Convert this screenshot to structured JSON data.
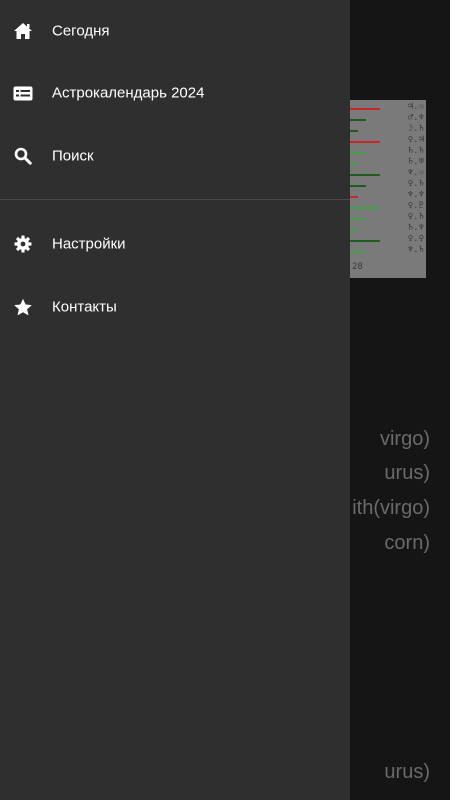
{
  "drawer": {
    "items": [
      {
        "label": "Сегодня",
        "icon": "home-icon"
      },
      {
        "label": "Астрокалендарь 2024",
        "icon": "calendar-list-icon"
      },
      {
        "label": "Поиск",
        "icon": "search-icon"
      },
      {
        "label": "Настройки",
        "icon": "gear-icon"
      },
      {
        "label": "Контакты",
        "icon": "star-icon"
      }
    ]
  },
  "background": {
    "chart_footer": "28",
    "chart_rows": [
      {
        "glyph": "♃.☉",
        "color": "#c62828"
      },
      {
        "glyph": "♂.♆",
        "color": "#1b5e20"
      },
      {
        "glyph": "☽.♄",
        "color": "#1b5e20"
      },
      {
        "glyph": "♀.♃",
        "color": "#c62828"
      },
      {
        "glyph": "♄.♄",
        "color": "#43a047"
      },
      {
        "glyph": "♄.♅",
        "color": "#43a047"
      },
      {
        "glyph": "♆.☉",
        "color": "#1b5e20"
      },
      {
        "glyph": "♀.♄",
        "color": "#1b5e20"
      },
      {
        "glyph": "♆.♆",
        "color": "#c62828"
      },
      {
        "glyph": "♀.♇",
        "color": "#43a047"
      },
      {
        "glyph": "♀.♄",
        "color": "#43a047"
      },
      {
        "glyph": "♄.♆",
        "color": "#43a047"
      },
      {
        "glyph": "♀.♀",
        "color": "#1b5e20"
      },
      {
        "glyph": "♆.♄",
        "color": "#43a047"
      }
    ],
    "lines": [
      "virgo)",
      "urus)",
      "ith(virgo)",
      "corn)",
      "urus)"
    ]
  },
  "colors": {
    "drawer_bg": "#2f2f2f",
    "app_bg": "#151515",
    "divider": "#4a4a4a",
    "text": "#ffffff"
  }
}
